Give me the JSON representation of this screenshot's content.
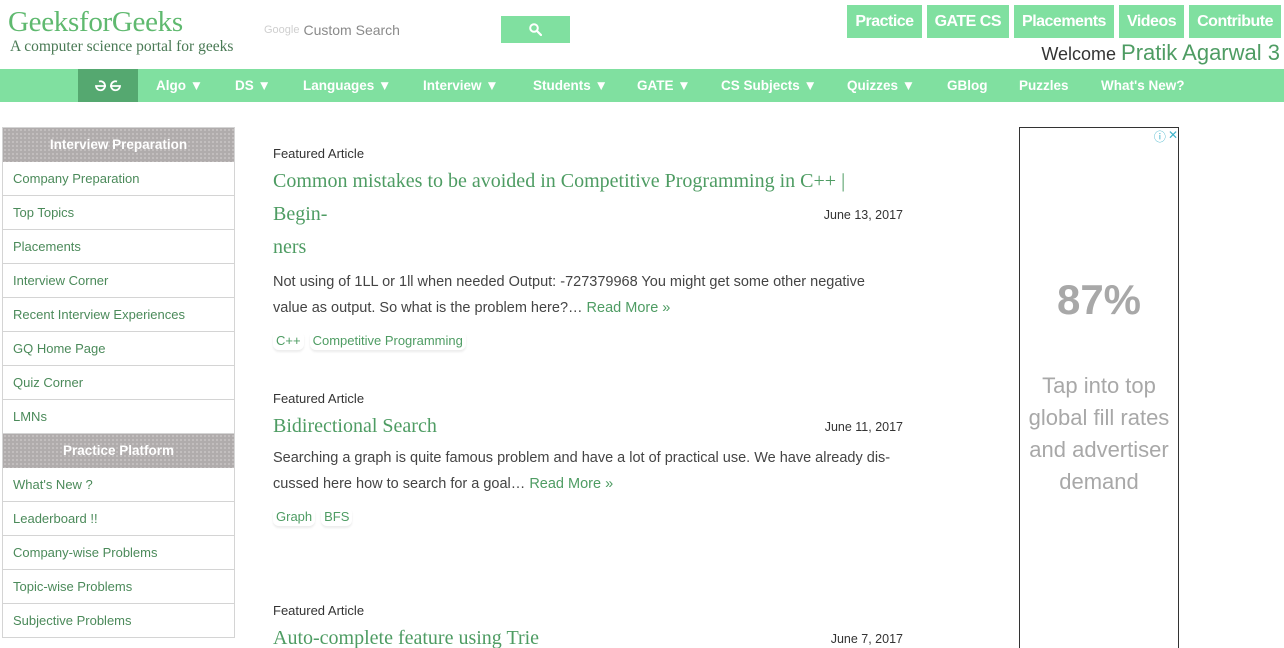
{
  "header": {
    "logo_title": "GeeksforGeeks",
    "logo_subtitle": "A computer science portal for geeks",
    "search_brand": "Google",
    "search_placeholder": "Custom Search",
    "top_buttons": [
      "Practice",
      "GATE CS",
      "Placements",
      "Videos",
      "Contribute"
    ],
    "welcome_label": "Welcome",
    "username": "Pratik Agarwal 3"
  },
  "nav": {
    "items": [
      "Algo ▼",
      "DS ▼",
      "Languages ▼",
      "Interview ▼",
      "Students ▼",
      "GATE ▼",
      "CS Subjects ▼",
      "Quizzes ▼",
      "GBlog",
      "Puzzles",
      "What's New?"
    ]
  },
  "sidebar": {
    "sections": [
      {
        "title": "Interview Preparation",
        "items": [
          "Company Preparation",
          "Top Topics",
          "Placements",
          "Interview Corner",
          "Recent Interview Experiences",
          "GQ Home Page",
          "Quiz Corner",
          "LMNs"
        ]
      },
      {
        "title": "Practice Platform",
        "items": [
          "What's New ?",
          "Leaderboard !!",
          "Company-wise Problems",
          "Topic-wise Problems",
          "Subjective Problems"
        ]
      }
    ]
  },
  "articles": [
    {
      "label": "Featured Article",
      "title_line1": "Common mistakes to be avoided in Competitive Programming in C++ | Begin-",
      "title_line2": "ners",
      "date": "June 13, 2017",
      "excerpt": "Not using of 1LL or 1ll when needed Output: -727379968 You might get some other negative value as output. So what is the problem here?…",
      "read_more": "Read More »",
      "tags": [
        "C++",
        "Competitive Programming"
      ]
    },
    {
      "label": "Featured Article",
      "title": "Bidirectional Search",
      "date": "June 11, 2017",
      "excerpt": "Searching a graph is quite famous problem and have a lot of practical use. We have already dis- cussed here how to search for a goal…",
      "read_more": "Read More »",
      "tags": [
        "Graph",
        "BFS"
      ]
    },
    {
      "label": "Featured Article",
      "title": "Auto-complete feature using Trie",
      "date": "June 7, 2017"
    }
  ],
  "ad": {
    "percent": "87%",
    "text": "Tap into top global fill rates and advertiser demand"
  },
  "colors": {
    "brand_green": "#80e0a0",
    "link_green": "#4e9c63",
    "nav_logo_bg": "#55a870"
  }
}
